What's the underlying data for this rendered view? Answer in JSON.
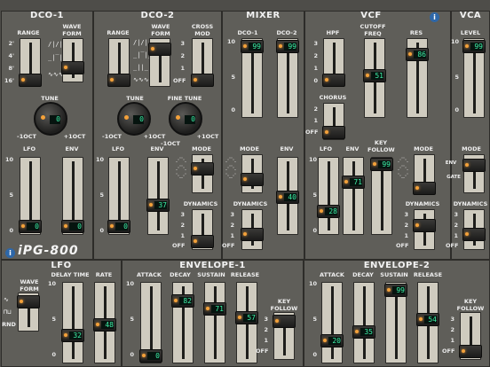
{
  "dco1": {
    "title": "DCO-1",
    "range_label": "RANGE",
    "waveform_label": "WAVE FORM",
    "range_scale": [
      "2'",
      "4'",
      "8'",
      "16'"
    ],
    "tune_label": "TUNE",
    "tune_value": "0",
    "tune_min": "-1OCT",
    "tune_max": "+1OCT",
    "lfo_label": "LFO",
    "env_label": "ENV",
    "lfo_value": "0",
    "env_value": "0"
  },
  "dco2": {
    "title": "DCO-2",
    "range_label": "RANGE",
    "waveform_label": "WAVE FORM",
    "crossmod_label": "CROSS MOD",
    "crossmod_scale": [
      "3",
      "2",
      "1",
      "OFF"
    ],
    "tune_label": "TUNE",
    "tune_value": "0",
    "tune_min": "-1OCT",
    "tune_max": "+1OCT",
    "finetune_label": "FINE TUNE",
    "finetune_value": "0",
    "finetune_min": "-1OCT",
    "finetune_max": "+1OCT",
    "lfo_label": "LFO",
    "env_label": "ENV",
    "lfo_value": "0",
    "env_value": "37",
    "mode_label": "MODE",
    "dynamics_label": "DYNAMICS",
    "dyn_scale": [
      "3",
      "2",
      "1",
      "OFF"
    ]
  },
  "mixer": {
    "title": "MIXER",
    "dco1_label": "DCO-1",
    "dco2_label": "DCO-2",
    "dco1_value": "99",
    "dco2_value": "99",
    "mode_label": "MODE",
    "env_label": "ENV",
    "env_value": "40",
    "dynamics_label": "DYNAMICS",
    "dyn_scale": [
      "3",
      "2",
      "1",
      "OFF"
    ]
  },
  "vcf": {
    "title": "VCF",
    "hpf_label": "HPF",
    "cutoff_label": "CUTOFF FREQ",
    "res_label": "RES",
    "cutoff_value": "51",
    "res_value": "86",
    "hpf_scale": [
      "3",
      "2",
      "1",
      "0"
    ],
    "chorus_label": "CHORUS",
    "chorus_scale": [
      "2",
      "1",
      "OFF"
    ],
    "lfo_label": "LFO",
    "env_label": "ENV",
    "keyfollow_label": "KEY FOLLOW",
    "lfo_value": "28",
    "env_value": "71",
    "keyfollow_value": "99",
    "mode_label": "MODE",
    "dynamics_label": "DYNAMICS",
    "dyn_scale": [
      "3",
      "2",
      "1",
      "OFF"
    ]
  },
  "vca": {
    "title": "VCA",
    "level_label": "LEVEL",
    "level_value": "99",
    "mode_label": "MODE",
    "mode_env": "ENV",
    "mode_gate": "GATE",
    "dynamics_label": "DYNAMICS",
    "dyn_scale": [
      "3",
      "2",
      "1",
      "OFF"
    ]
  },
  "lfo": {
    "title": "LFO",
    "waveform_label": "WAVE FORM",
    "rnd_label": "RND",
    "delay_label": "DELAY TIME",
    "rate_label": "RATE",
    "delay_value": "32",
    "rate_value": "48"
  },
  "env1": {
    "title": "ENVELOPE-1",
    "attack_label": "ATTACK",
    "decay_label": "DECAY",
    "sustain_label": "SUSTAIN",
    "release_label": "RELEASE",
    "attack_value": "0",
    "decay_value": "82",
    "sustain_value": "71",
    "release_value": "57",
    "keyfollow_label": "KEY FOLLOW",
    "kf_scale": [
      "3",
      "2",
      "1",
      "OFF"
    ]
  },
  "env2": {
    "title": "ENVELOPE-2",
    "attack_label": "ATTACK",
    "decay_label": "DECAY",
    "sustain_label": "SUSTAIN",
    "release_label": "RELEASE",
    "attack_value": "20",
    "decay_value": "35",
    "sustain_value": "99",
    "release_value": "54",
    "keyfollow_label": "KEY FOLLOW",
    "kf_scale": [
      "3",
      "2",
      "1",
      "OFF"
    ]
  },
  "scale10": [
    "10",
    "5",
    "0"
  ],
  "brand": {
    "logo": "iPG-800",
    "info_glyph": "i"
  }
}
